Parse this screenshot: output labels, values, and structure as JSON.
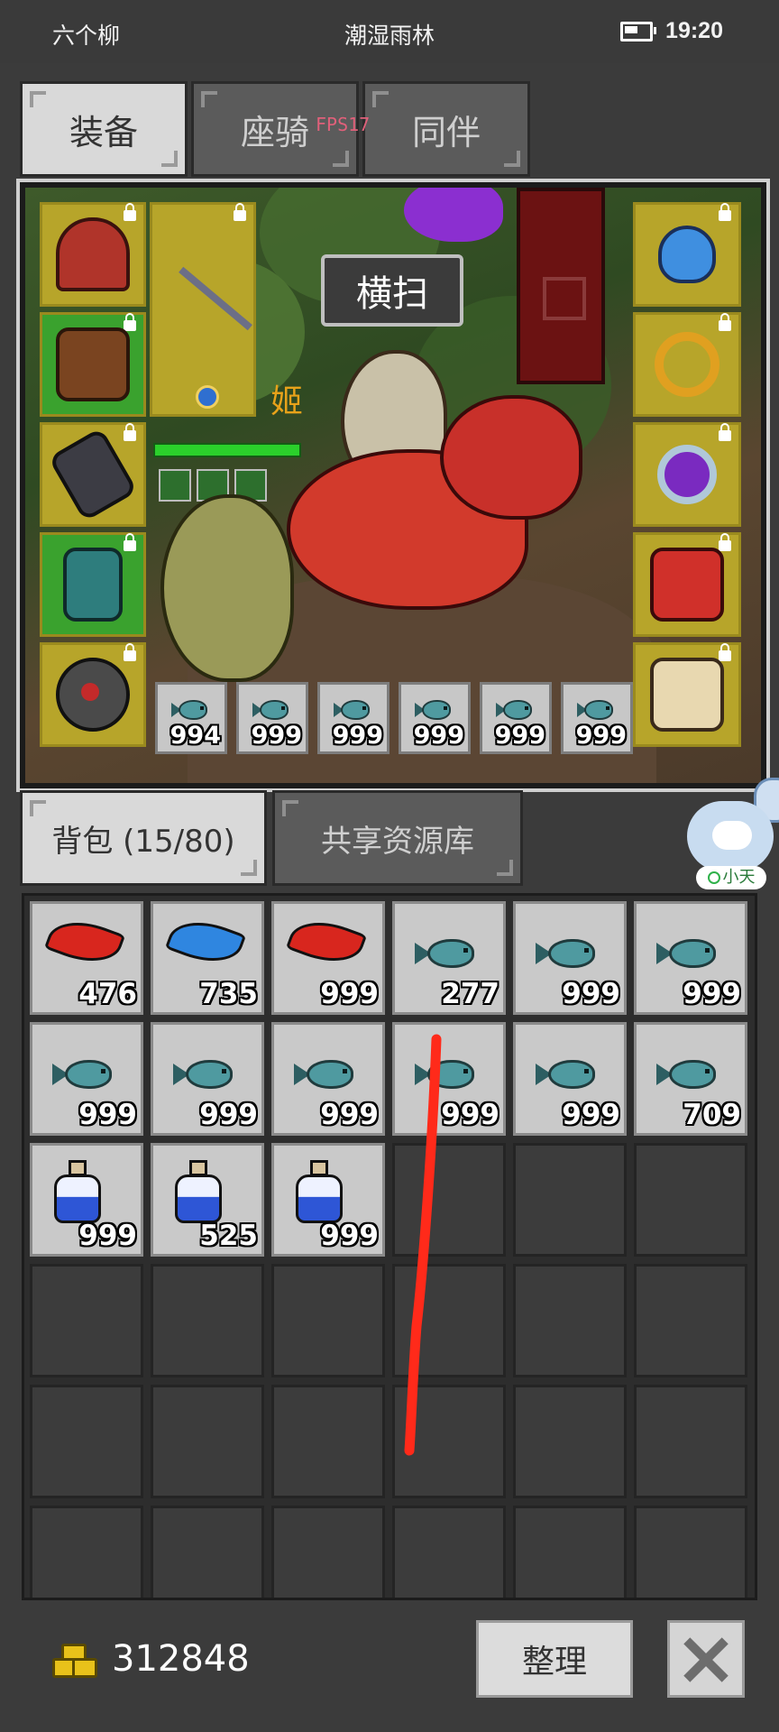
{
  "status_bar": {
    "carrier": "六个柳",
    "location": "潮湿雨林",
    "time": "19:20"
  },
  "tabs": [
    {
      "label": "装备",
      "active": true
    },
    {
      "label": "座骑",
      "active": false
    },
    {
      "label": "同伴",
      "active": false
    }
  ],
  "fps_overlay": "FPS17",
  "scene": {
    "skill_label": "横扫",
    "player_name": "姬",
    "left_slots": [
      "helmet",
      "armor",
      "gloves",
      "boots",
      "amulet"
    ],
    "weapon_slot": "trident",
    "right_slots": [
      "necklace",
      "ring",
      "ring2",
      "dragon-mount",
      "cat-pet"
    ],
    "quick_items": [
      "994",
      "999",
      "999",
      "999",
      "999",
      "999"
    ]
  },
  "inventory_tabs": [
    {
      "label": "背包 (15/80)",
      "active": true
    },
    {
      "label": "共享资源库",
      "active": false
    }
  ],
  "inventory": [
    {
      "icon": "red-feather",
      "count": "476"
    },
    {
      "icon": "blue-feather",
      "count": "735"
    },
    {
      "icon": "red-feather",
      "count": "999"
    },
    {
      "icon": "fish",
      "count": "277"
    },
    {
      "icon": "fish",
      "count": "999"
    },
    {
      "icon": "fish",
      "count": "999"
    },
    {
      "icon": "fish",
      "count": "999"
    },
    {
      "icon": "fish",
      "count": "999"
    },
    {
      "icon": "fish",
      "count": "999"
    },
    {
      "icon": "fish",
      "count": "999"
    },
    {
      "icon": "fish",
      "count": "999"
    },
    {
      "icon": "fish",
      "count": "709"
    },
    {
      "icon": "potion",
      "count": "999"
    },
    {
      "icon": "potion",
      "count": "525"
    },
    {
      "icon": "potion",
      "count": "999"
    }
  ],
  "gold": "312848",
  "sort_button": "整理",
  "assistant_label": "小天",
  "colors": {
    "slot_yellow": "#b7a52a",
    "slot_green": "#3aa22e",
    "gold": "#e8c21a",
    "annotation_red": "#ff2a1a"
  }
}
